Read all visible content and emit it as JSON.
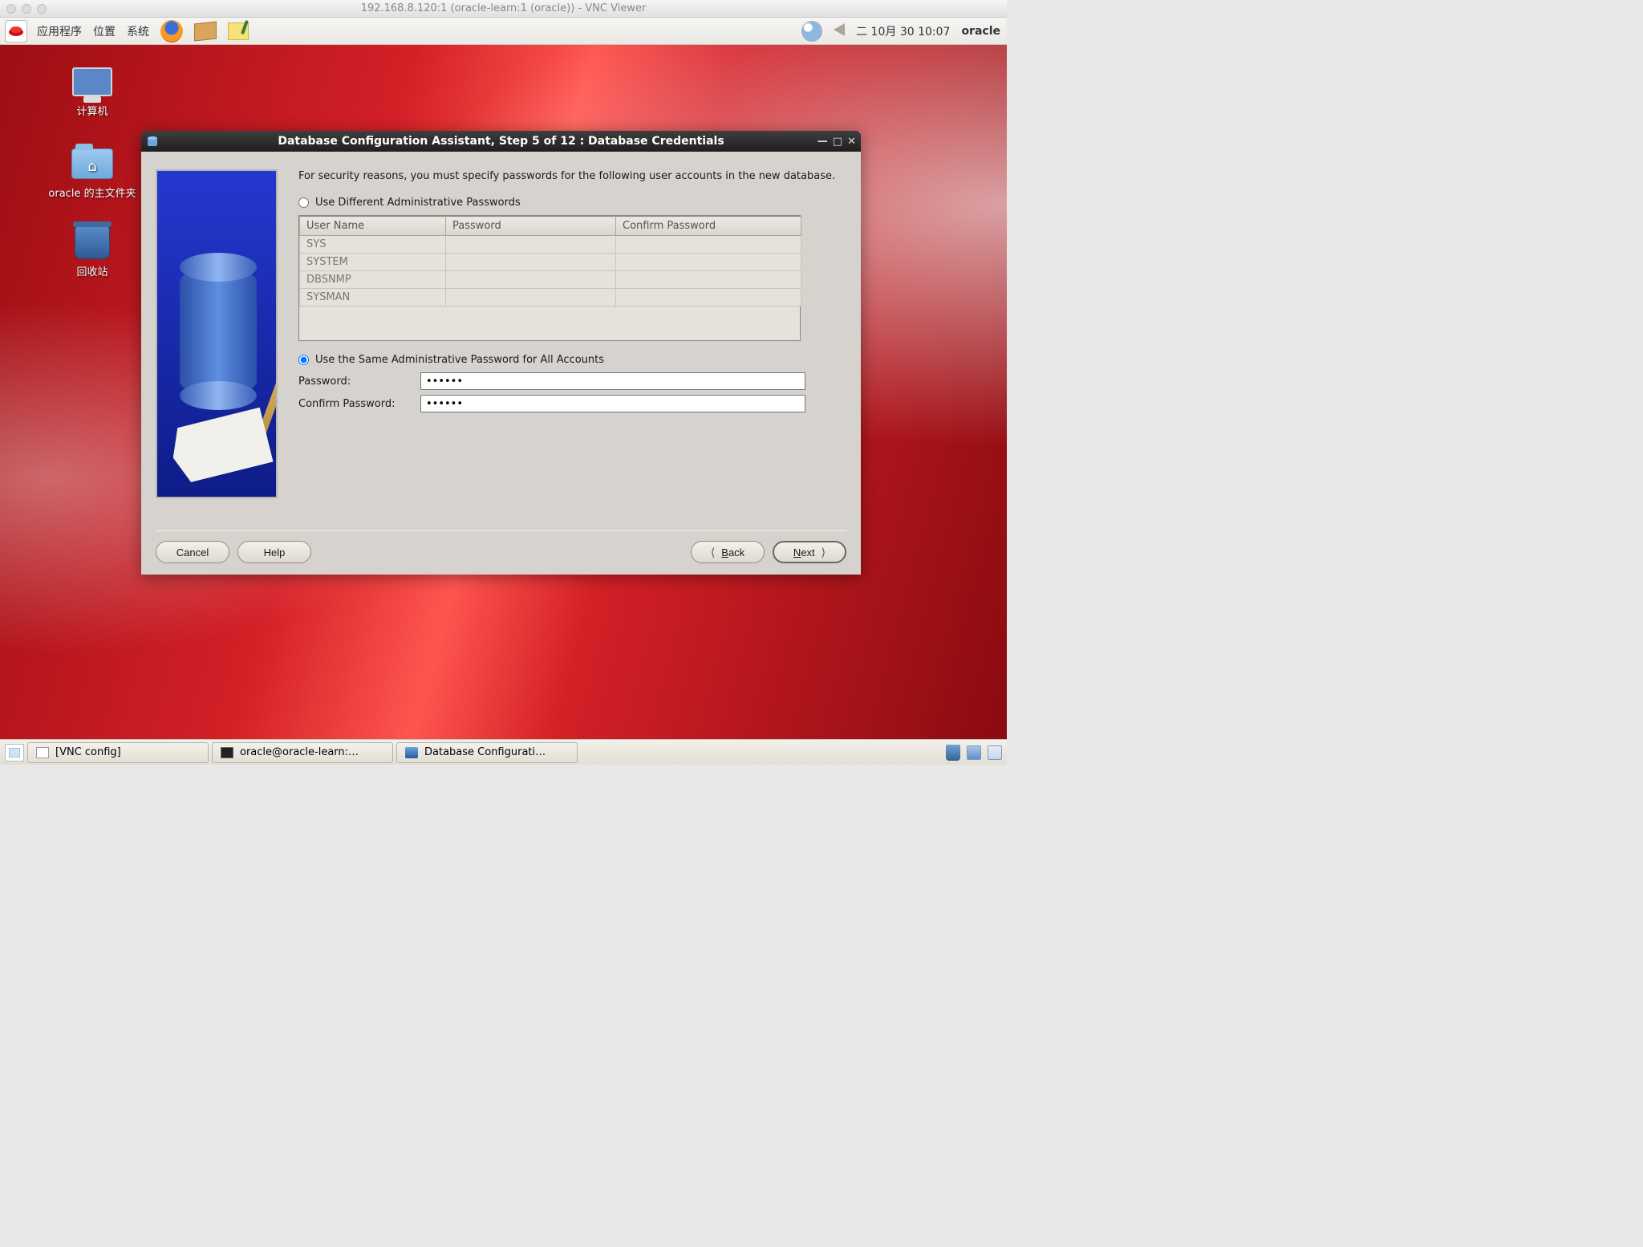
{
  "mac_title": "192.168.8.120:1 (oracle-learn:1 (oracle)) - VNC Viewer",
  "gnome": {
    "apps": "应用程序",
    "places": "位置",
    "system": "系统",
    "date": "二  10月 30 10:07",
    "user": "oracle"
  },
  "desktop_icons": {
    "computer": "计算机",
    "home": "oracle 的主文件夹",
    "trash": "回收站"
  },
  "dialog": {
    "title": "Database Configuration Assistant, Step 5 of 12 : Database Credentials",
    "intro": "For security reasons, you must specify passwords for the following user accounts in the new database.",
    "radio_diff": "Use Different Administrative Passwords",
    "radio_same": "Use the Same Administrative Password for All Accounts",
    "selected_option": "same",
    "table": {
      "headers": {
        "user": "User Name",
        "pw": "Password",
        "cpw": "Confirm Password"
      },
      "rows": [
        "SYS",
        "SYSTEM",
        "DBSNMP",
        "SYSMAN"
      ]
    },
    "password_label": "Password:",
    "confirm_label": "Confirm Password:",
    "password_value": "******",
    "confirm_value": "******",
    "buttons": {
      "cancel": "Cancel",
      "help": "Help",
      "back": "Back",
      "next": "Next"
    }
  },
  "taskbar": {
    "vnc": "[VNC config]",
    "term": "oracle@oracle-learn:…",
    "dbca": "Database Configurati…"
  }
}
